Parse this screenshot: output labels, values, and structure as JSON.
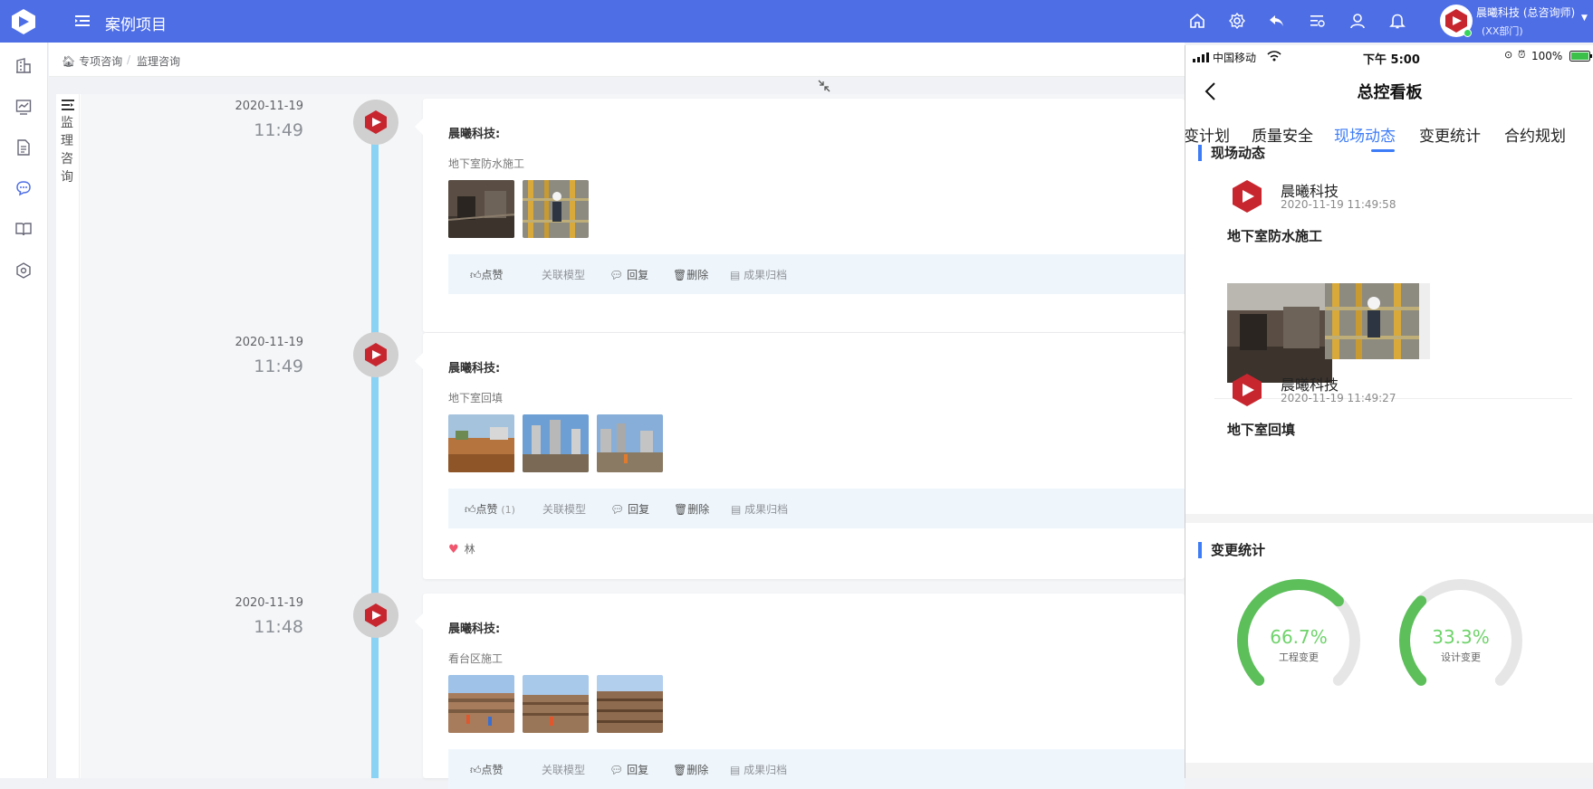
{
  "header": {
    "title": "案例项目",
    "user_name": "晨曦科技 (总咨询师)",
    "user_dept": "(XX部门)",
    "icons": [
      "home-icon",
      "settings-icon",
      "reply-icon",
      "list-icon",
      "user-icon",
      "bell-icon"
    ]
  },
  "sidebar": {
    "items": [
      "building-icon",
      "chart-icon",
      "document-icon",
      "chat-icon",
      "book-icon",
      "gear-hex-icon"
    ],
    "active": "chat-icon"
  },
  "breadcrumb": {
    "home": "专项咨询",
    "current": "监理咨询"
  },
  "vertical_tab": {
    "label": "监理咨询"
  },
  "timeline": {
    "entries": [
      {
        "date": "2020-11-19",
        "time": "11:49",
        "author": "晨曦科技:",
        "desc": "地下室防水施工",
        "like": "点赞",
        "like_count": "",
        "link_model": "关联模型",
        "reply": "回复",
        "delete": "删除",
        "archive": "成果归档"
      },
      {
        "date": "2020-11-19",
        "time": "11:49",
        "author": "晨曦科技:",
        "desc": "地下室回填",
        "like": "点赞",
        "like_count": "(1)",
        "link_model": "关联模型",
        "reply": "回复",
        "delete": "删除",
        "archive": "成果归档",
        "liked_by": "林"
      },
      {
        "date": "2020-11-19",
        "time": "11:48",
        "author": "晨曦科技:",
        "desc": "看台区施工",
        "like": "点赞",
        "like_count": "",
        "link_model": "关联模型",
        "reply": "回复",
        "delete": "删除",
        "archive": "成果归档"
      }
    ]
  },
  "phone": {
    "carrier": "中国移动",
    "clock": "下午 5:00",
    "battery": "100%",
    "title": "总控看板",
    "tabs": [
      "变计划",
      "质量安全",
      "现场动态",
      "变更统计",
      "合约规划"
    ],
    "active_tab": "现场动态",
    "section_feed": "现场动态",
    "feed": [
      {
        "name": "晨曦科技",
        "time": "2020-11-19 11:49:58",
        "title": "地下室防水施工"
      },
      {
        "name": "晨曦科技",
        "time": "2020-11-19 11:49:27",
        "title": "地下室回填"
      }
    ],
    "section_stats": "变更统计",
    "gauges": [
      {
        "value": "66.7%",
        "fraction": 0.667,
        "label": "工程变更"
      },
      {
        "value": "33.3%",
        "fraction": 0.333,
        "label": "设计变更"
      }
    ]
  },
  "colors": {
    "header_bg": "#4e6ee6",
    "accent": "#3d7cf7",
    "timeline": "#8bd3f5",
    "gauge": "#5cbf5a",
    "gauge_track": "#e6e6e6",
    "brand_red": "#c8262f"
  }
}
